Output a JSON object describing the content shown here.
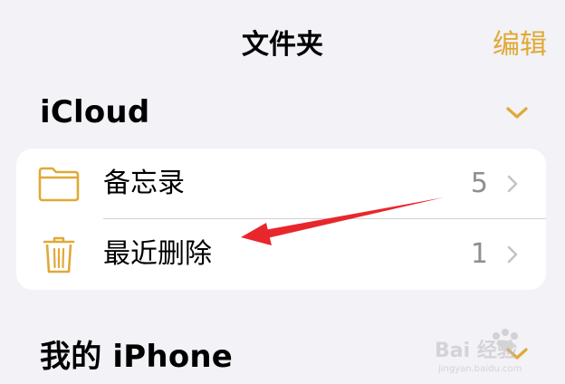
{
  "nav": {
    "title": "文件夹",
    "edit_label": "编辑"
  },
  "sections": [
    {
      "title": "iCloud",
      "expanded": true,
      "items": [
        {
          "label": "备忘录",
          "count": "5",
          "icon": "folder-icon"
        },
        {
          "label": "最近删除",
          "count": "1",
          "icon": "trash-icon"
        }
      ]
    },
    {
      "title": "我的 iPhone",
      "expanded": true
    }
  ],
  "watermark": {
    "brand": "Bai 经验",
    "url": "jingyan.baidu.com"
  },
  "colors": {
    "accent": "#e0a936",
    "background": "#f2f2f7",
    "card": "#ffffff",
    "secondary_text": "#8e8e93",
    "chevron": "#c4c4c7",
    "separator": "#d1d1d6",
    "annotation_arrow": "#e8272c"
  }
}
